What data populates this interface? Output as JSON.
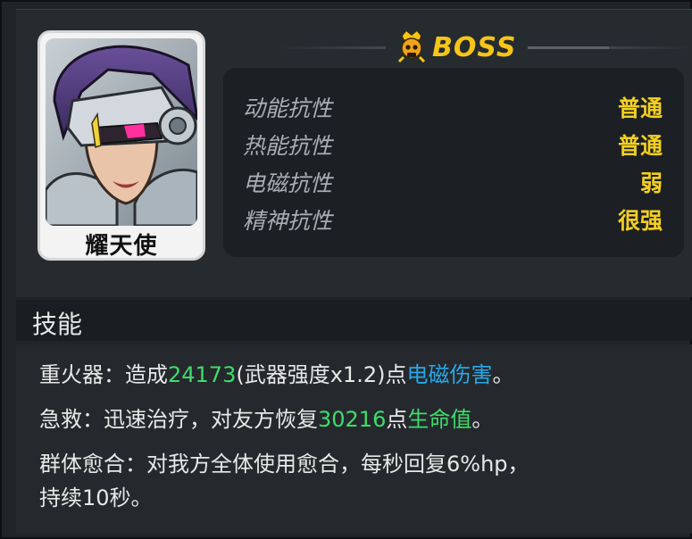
{
  "portrait": {
    "name": "耀天使"
  },
  "header": {
    "badge_text": "BOSS"
  },
  "resistances": [
    {
      "label": "动能抗性",
      "value": "普通"
    },
    {
      "label": "热能抗性",
      "value": "普通"
    },
    {
      "label": "电磁抗性",
      "value": "弱"
    },
    {
      "label": "精神抗性",
      "value": "很强"
    }
  ],
  "skills": {
    "title": "技能",
    "items": [
      {
        "prefix": "重火器：造成",
        "number": "24173",
        "middle": "(武器强度x1.2)点",
        "type": "电磁伤害",
        "suffix": "。"
      },
      {
        "prefix": "急救：迅速治疗，对友方恢复",
        "number": "30216",
        "middle": "点",
        "type": "生命值",
        "suffix": "。"
      },
      {
        "line1": "群体愈合：对我方全体使用愈合，每秒回复6%hp，",
        "line2": "持续10秒。"
      }
    ]
  },
  "colors": {
    "accent_gold": "#f5c518",
    "value_yellow": "#f3cf22",
    "number_green": "#3fdc6b",
    "damage_blue": "#29a8e6"
  }
}
